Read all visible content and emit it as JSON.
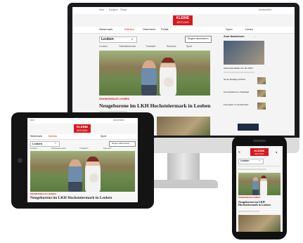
{
  "site": {
    "logo_top": "KLEINE",
    "logo_bottom": "ZEITUNG",
    "region": "Leoben",
    "follow_button": "Region abonnieren",
    "topnav": [
      "Steiermark",
      "Kärnten",
      "Österreich",
      "Politik",
      "Sport",
      "Leben"
    ],
    "subnav": [
      "Leoben",
      "Obersteiermark",
      "Trofaiach",
      "Eisenerz",
      "Sport"
    ],
    "topbar": [
      "Abo",
      "Epaper",
      "Shop",
      "Anmelden"
    ],
    "kicker": "KRANKENHAUS LEOBEN",
    "headline": "Neugeborene im LKH Hochsteiermark in Leoben",
    "headline_short_tablet": "Neugeborene im LKH Hochsteiermark in Leoben",
    "headline_phone": "Neugeborene im LKH Hochsteiermark in Leoben",
    "sidebar_title": "Zum Nachlesen",
    "sidebar_items": [
      "Spitzenkandidaten für die Wahl",
      "Neuer Radweg eröffnet",
      "Konzertabend im Stadtsaal",
      "Feuerwehr im Großeinsatz"
    ]
  },
  "colors": {
    "brand_red": "#d6191f",
    "monitor_bezel": "#1b1b1d",
    "photo_green": "#6f8a4e"
  }
}
